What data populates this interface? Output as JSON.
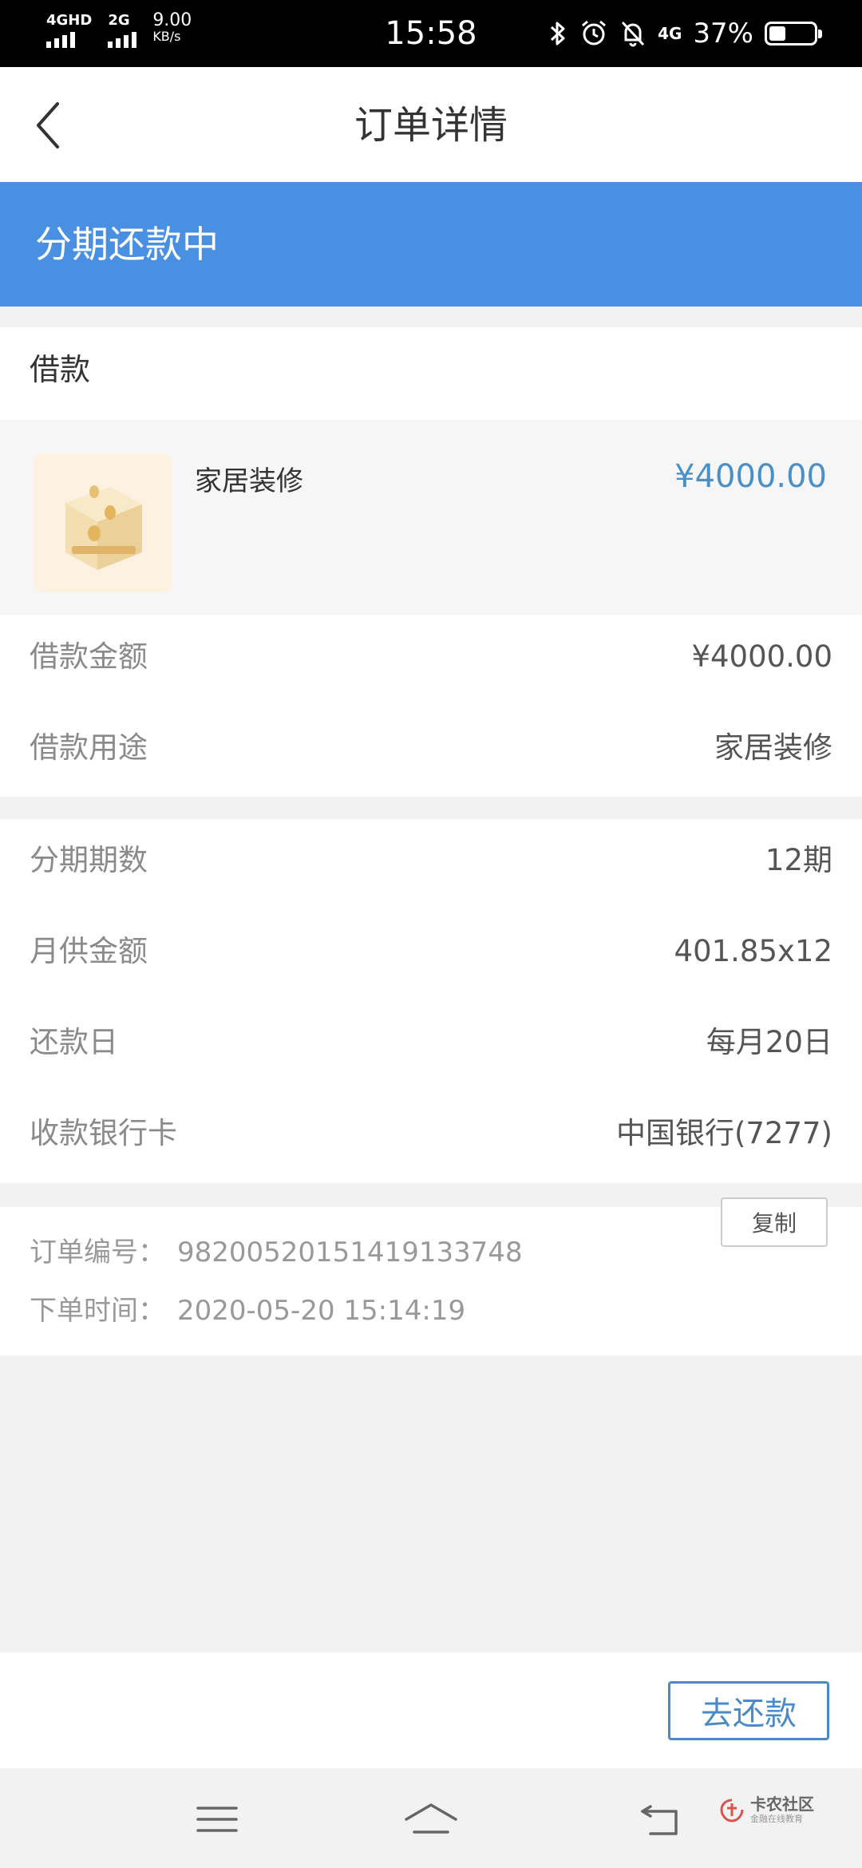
{
  "status_bar": {
    "network1": "4GHD",
    "network2": "2G",
    "speed_value": "9.00",
    "speed_unit": "KB/s",
    "time": "15:58",
    "network3": "4G",
    "battery_percent_text": "37%",
    "battery_level": 0.37,
    "icons": [
      "bluetooth-icon",
      "alarm-icon",
      "bell-muted-icon"
    ]
  },
  "header": {
    "title": "订单详情",
    "back_icon": "chevron-left-icon"
  },
  "banner": {
    "status_text": "分期还款中",
    "color": "#4a90e2"
  },
  "loan": {
    "section_title": "借款",
    "product": {
      "name": "家居装修",
      "price": "¥4000.00",
      "image_icon": "coin-box-icon"
    },
    "rows": [
      {
        "label": "借款金额",
        "value": "¥4000.00"
      },
      {
        "label": "借款用途",
        "value": "家居装修"
      }
    ]
  },
  "installment": {
    "rows": [
      {
        "label": "分期期数",
        "value": "12期"
      },
      {
        "label": "月供金额",
        "value": "401.85x12"
      },
      {
        "label": "还款日",
        "value": "每月20日"
      },
      {
        "label": "收款银行卡",
        "value": "中国银行(7277)"
      }
    ]
  },
  "order": {
    "number_label": "订单编号：",
    "number": "982005201514191337 48",
    "time_label": "下单时间：",
    "time": "2020-05-20 15:14:19",
    "copy_label": "复制"
  },
  "footer": {
    "pay_label": "去还款",
    "accent": "#4a8ac8"
  },
  "navbar": {
    "icons": [
      "menu-icon",
      "home-icon",
      "back-icon"
    ]
  },
  "watermark": {
    "title": "卡农社区",
    "subtitle": "金融在线教育"
  }
}
